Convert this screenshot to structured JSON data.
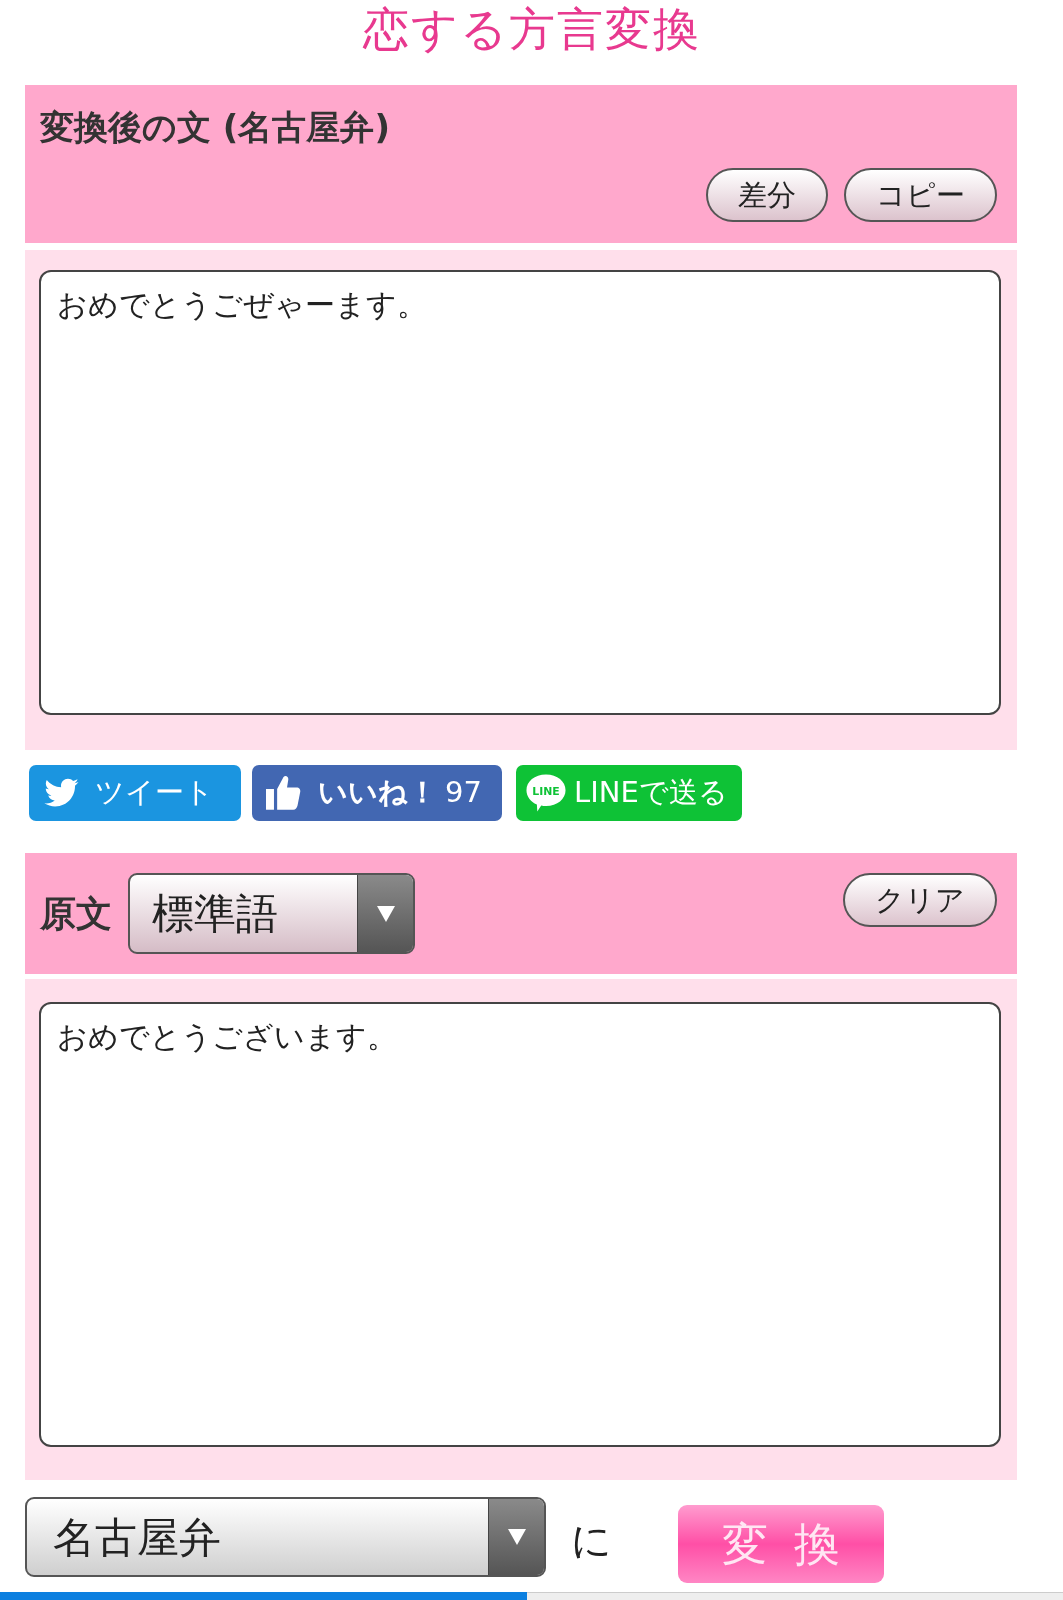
{
  "title": "恋する方言変換",
  "result": {
    "heading": "変換後の文 (名古屋弁)",
    "buttons": [
      "差分",
      "コピー"
    ],
    "text": "おめでとうごぜゃーます。"
  },
  "share": [
    {
      "kind": "tweet",
      "label": "ツイート"
    },
    {
      "kind": "like",
      "label": "いいね！",
      "count": "97"
    },
    {
      "kind": "line",
      "label": "LINEで送る",
      "icon_text": "LINE"
    }
  ],
  "source": {
    "heading": "原文",
    "dialect": "標準語",
    "buttons": [
      "クリア"
    ],
    "text": "おめでとうございます。"
  },
  "convert": {
    "target": "名古屋弁",
    "particle": "に",
    "button": "変換"
  }
}
